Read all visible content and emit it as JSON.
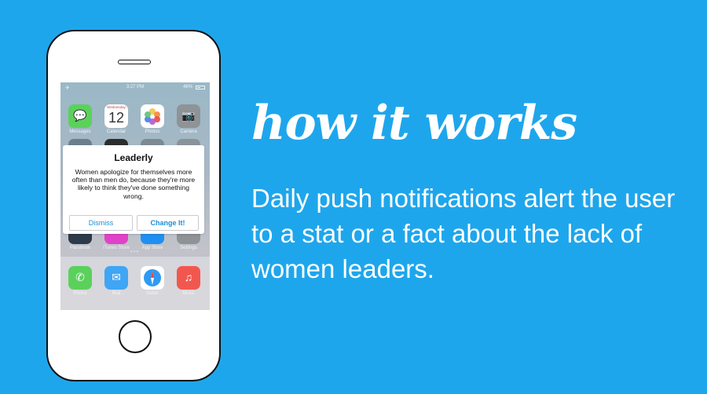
{
  "colors": {
    "background": "#1ea6ec",
    "accent": "#1b8fd6"
  },
  "headline": "how it works",
  "description": "Daily push notifications alert the user to a stat or a fact about the lack of women leaders.",
  "phone": {
    "status_bar": {
      "time": "3:27 PM",
      "battery": "46%",
      "airplane_icon": "airplane-icon",
      "battery_icon": "battery-icon"
    },
    "calendar": {
      "weekday": "Wednesday",
      "day": "12"
    },
    "apps_row1": [
      {
        "label": "Messages",
        "icon": "messages-icon",
        "color": "#5bd15c"
      },
      {
        "label": "Calendar",
        "icon": "calendar-icon",
        "color": "#ffffff"
      },
      {
        "label": "Photos",
        "icon": "photos-icon",
        "color": "#ffffff"
      },
      {
        "label": "Camera",
        "icon": "camera-icon",
        "color": "#8e9396"
      }
    ],
    "apps_row4": [
      {
        "label": "Passbook",
        "icon": "passbook-icon",
        "color": "#2c3a4a"
      },
      {
        "label": "iTunes Store",
        "icon": "itunes-icon",
        "color": "#e043c8"
      },
      {
        "label": "App Store",
        "icon": "app-store-icon",
        "color": "#1f8ff2"
      },
      {
        "label": "Settings",
        "icon": "settings-icon",
        "color": "#8e9396"
      }
    ],
    "dock": [
      {
        "label": "Phone",
        "icon": "phone-icon",
        "color": "#5bd15c"
      },
      {
        "label": "Mail",
        "icon": "mail-icon",
        "color": "#3fa5f5"
      },
      {
        "label": "Safari",
        "icon": "safari-icon",
        "color": "#ffffff"
      },
      {
        "label": "Music",
        "icon": "music-icon",
        "color": "#f2574f"
      }
    ]
  },
  "alert": {
    "title": "Leaderly",
    "message": "Women apologize for themselves more often than men do, because they're more likely to think they've done something wrong.",
    "dismiss": "Dismiss",
    "change": "Change It!"
  }
}
